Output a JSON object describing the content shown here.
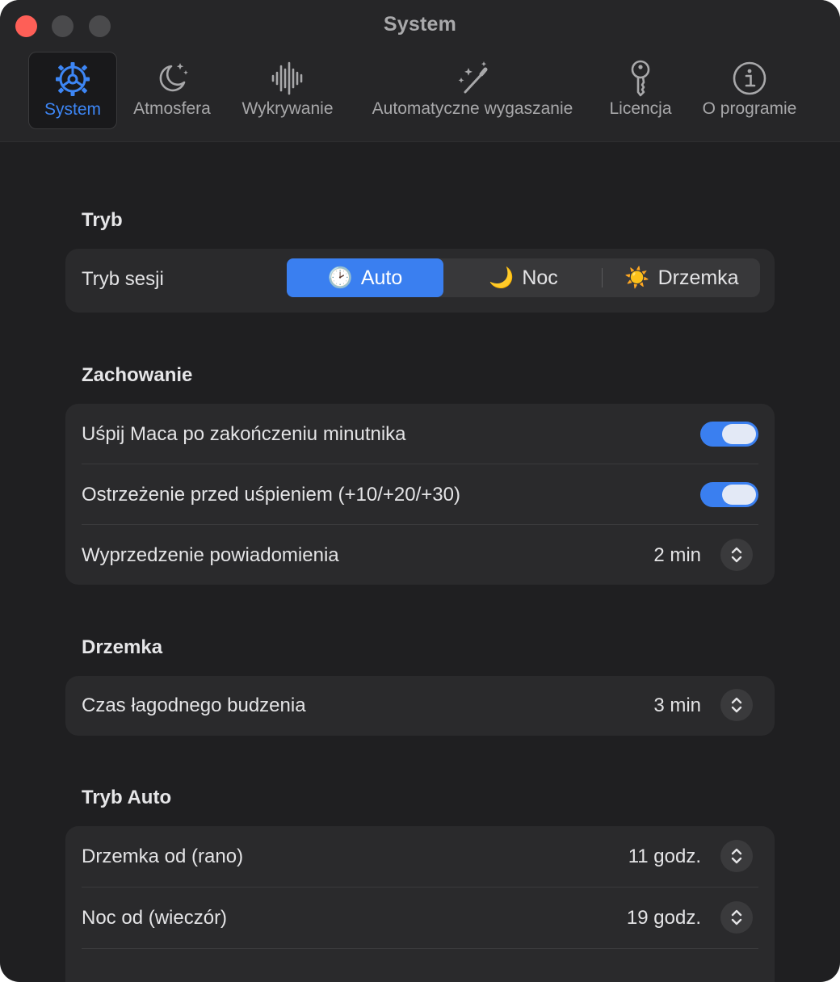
{
  "window": {
    "title": "System"
  },
  "tabs": [
    {
      "label": "System",
      "icon": "gear-icon",
      "active": true
    },
    {
      "label": "Atmosfera",
      "icon": "moon-stars-icon"
    },
    {
      "label": "Wykrywanie",
      "icon": "waveform-icon"
    },
    {
      "label": "Automatyczne wygaszanie",
      "icon": "magic-wand-icon"
    },
    {
      "label": "Licencja",
      "icon": "key-icon"
    },
    {
      "label": "O programie",
      "icon": "info-icon"
    }
  ],
  "sections": {
    "mode": {
      "title": "Tryb",
      "session_label": "Tryb sesji",
      "options": [
        {
          "label": "Auto",
          "emoji": "🕑",
          "selected": true
        },
        {
          "label": "Noc",
          "emoji": "🌙"
        },
        {
          "label": "Drzemka",
          "emoji": "☀️"
        }
      ]
    },
    "behavior": {
      "title": "Zachowanie",
      "rows": [
        {
          "label": "Uśpij Maca po zakończeniu minutnika",
          "on": true
        },
        {
          "label": "Ostrzeżenie przed uśpieniem (+10/+20/+30)",
          "on": true
        },
        {
          "label": "Wyprzedzenie powiadomienia",
          "value": "2 min"
        }
      ]
    },
    "nap": {
      "title": "Drzemka",
      "rows": [
        {
          "label": "Czas łagodnego budzenia",
          "value": "3 min"
        }
      ]
    },
    "auto": {
      "title": "Tryb Auto",
      "rows": [
        {
          "label": "Drzemka od (rano)",
          "value": "11 godz."
        },
        {
          "label": "Noc od (wieczór)",
          "value": "19 godz."
        }
      ]
    }
  },
  "colors": {
    "accent": "#3a7ff0",
    "window_bg": "#1f1f21",
    "group_bg": "#2a2a2c",
    "close": "#fe5f57"
  }
}
